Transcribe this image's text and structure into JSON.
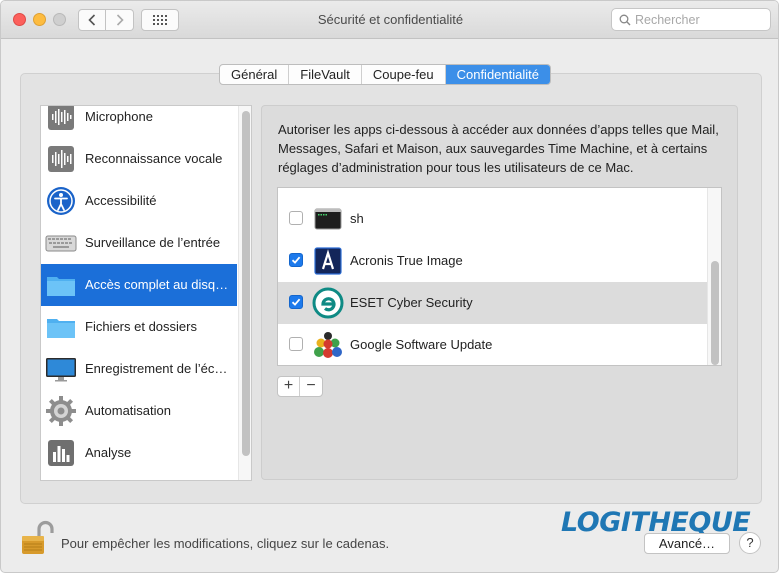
{
  "window": {
    "title": "Sécurité et confidentialité",
    "search_placeholder": "Rechercher"
  },
  "tabs": [
    {
      "label": "Général",
      "active": false
    },
    {
      "label": "FileVault",
      "active": false
    },
    {
      "label": "Coupe-feu",
      "active": false
    },
    {
      "label": "Confidentialité",
      "active": true
    }
  ],
  "sidebar": {
    "items": [
      {
        "label": "Microphone",
        "icon": "microphone-icon",
        "selected": false
      },
      {
        "label": "Reconnaissance vocale",
        "icon": "speech-recognition-icon",
        "selected": false
      },
      {
        "label": "Accessibilité",
        "icon": "accessibility-icon",
        "selected": false
      },
      {
        "label": "Surveillance de l’entrée",
        "icon": "keyboard-icon",
        "selected": false
      },
      {
        "label": "Accès complet au disq…",
        "icon": "folder-icon",
        "selected": true
      },
      {
        "label": "Fichiers et dossiers",
        "icon": "folder-icon",
        "selected": false
      },
      {
        "label": "Enregistrement de l’éc…",
        "icon": "display-icon",
        "selected": false
      },
      {
        "label": "Automatisation",
        "icon": "gear-icon",
        "selected": false
      },
      {
        "label": "Analyse",
        "icon": "analytics-icon",
        "selected": false
      }
    ]
  },
  "panel": {
    "description": "Autoriser les apps ci-dessous à accéder aux données d’apps telles que Mail, Messages, Safari et Maison, aux sauvegardes Time Machine, et à certains réglages d’administration pour tous les utilisateurs de ce Mac.",
    "apps": [
      {
        "name": "sh",
        "checked": false,
        "icon": "terminal-icon",
        "highlighted": false
      },
      {
        "name": "Acronis True Image",
        "checked": true,
        "icon": "acronis-icon",
        "highlighted": false
      },
      {
        "name": "ESET Cyber Security",
        "checked": true,
        "icon": "eset-icon",
        "highlighted": true
      },
      {
        "name": "Google Software Update",
        "checked": false,
        "icon": "google-update-icon",
        "highlighted": false
      }
    ],
    "add_label": "+",
    "remove_label": "−"
  },
  "footer": {
    "lock_text": "Pour empêcher les modifications, cliquez sur le cadenas.",
    "advanced_label": "Avancé…",
    "help_label": "?",
    "watermark": "LOGITHEQUE"
  },
  "colors": {
    "accent": "#1b6fd9",
    "tab_active": "#3c8fe8",
    "checkbox_on": "#1d7aec",
    "watermark": "#1f77b4"
  }
}
